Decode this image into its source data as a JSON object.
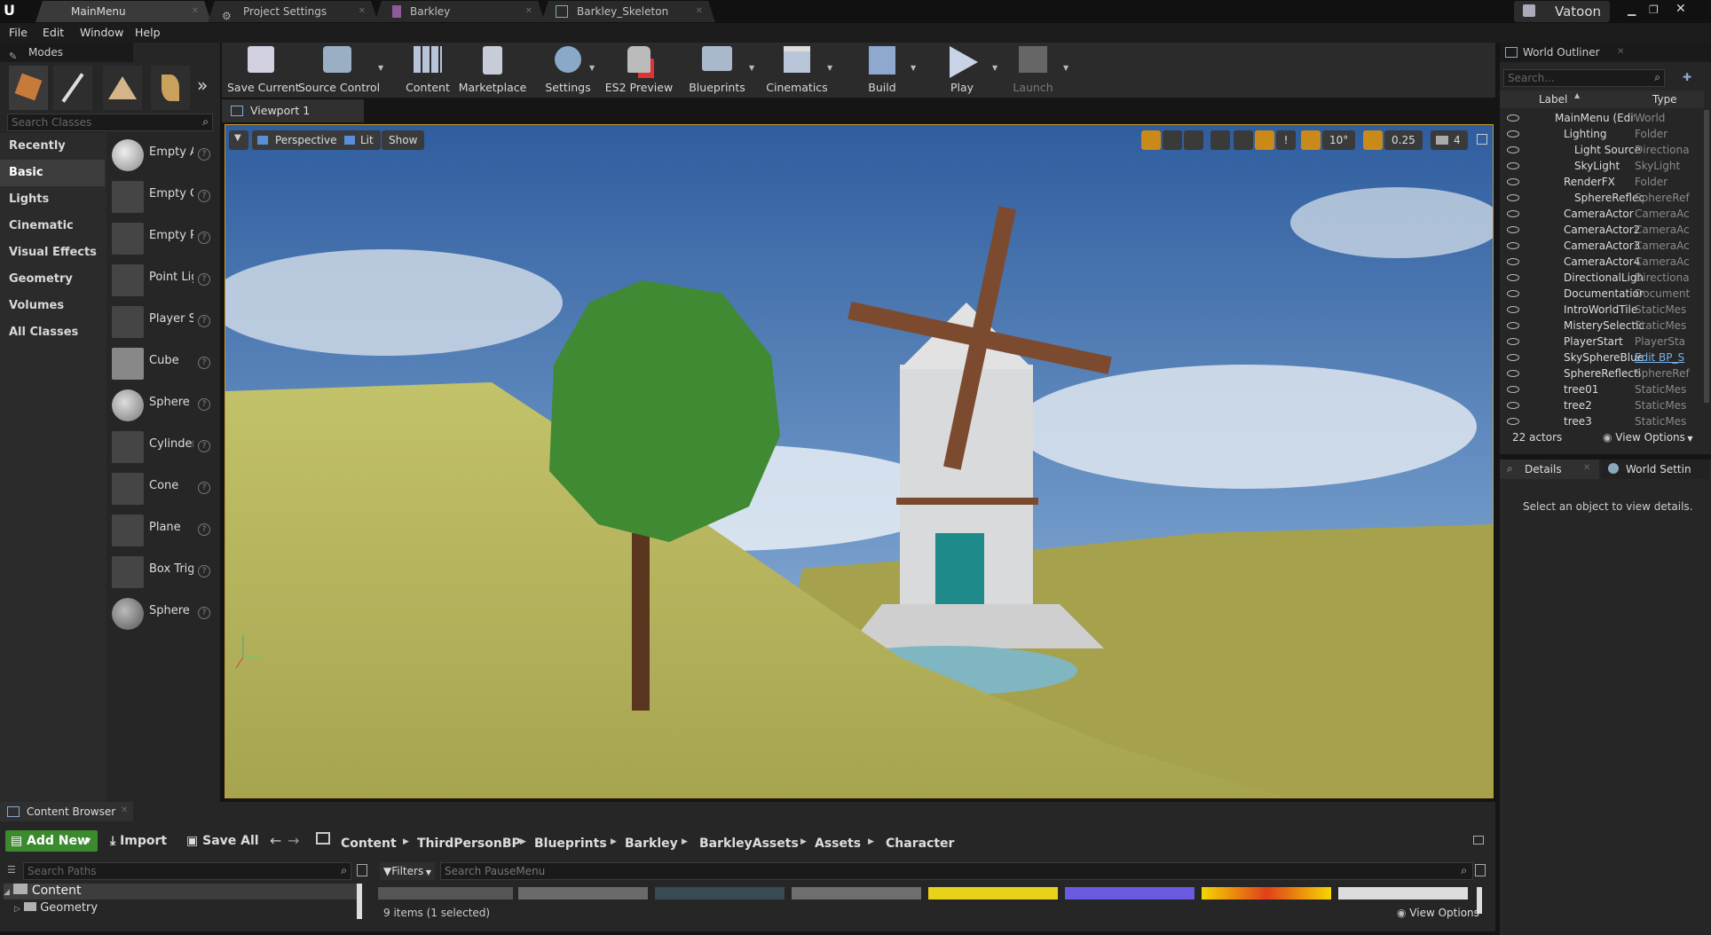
{
  "tabs": [
    {
      "label": "MainMenu"
    },
    {
      "label": "Project Settings"
    },
    {
      "label": "Barkley"
    },
    {
      "label": "Barkley_Skeleton"
    }
  ],
  "user": "Vatoon",
  "menu": [
    "File",
    "Edit",
    "Window",
    "Help"
  ],
  "modes": {
    "title": "Modes",
    "search_placeholder": "Search Classes",
    "categories": [
      "Recently Placed",
      "Basic",
      "Lights",
      "Cinematic",
      "Visual Effects",
      "Geometry",
      "Volumes",
      "All Classes"
    ],
    "items": [
      "Empty A",
      "Empty C",
      "Empty P",
      "Point Lig",
      "Player S",
      "Cube",
      "Sphere",
      "Cylinder",
      "Cone",
      "Plane",
      "Box Trig",
      "Sphere"
    ]
  },
  "toolbar": [
    "Save Current",
    "Source Control",
    "Content",
    "Marketplace",
    "Settings",
    "ES2 Preview",
    "Blueprints",
    "Cinematics",
    "Build",
    "Play",
    "Launch"
  ],
  "viewport": {
    "tab": "Viewport 1",
    "perspective": "Perspective",
    "lit": "Lit",
    "show": "Show",
    "rot": "10°",
    "scale": "0.25",
    "cam": "4"
  },
  "outliner": {
    "title": "World Outliner",
    "search": "Search...",
    "col_label": "Label",
    "col_type": "Type",
    "rows": [
      {
        "label": "MainMenu (Edito",
        "type": "World"
      },
      {
        "label": "Lighting",
        "type": "Folder"
      },
      {
        "label": "Light Source",
        "type": "Directiona"
      },
      {
        "label": "SkyLight",
        "type": "SkyLight"
      },
      {
        "label": "RenderFX",
        "type": "Folder"
      },
      {
        "label": "SphereReflec",
        "type": "SphereRef"
      },
      {
        "label": "CameraActor",
        "type": "CameraAc"
      },
      {
        "label": "CameraActor2",
        "type": "CameraAc"
      },
      {
        "label": "CameraActor3",
        "type": "CameraAc"
      },
      {
        "label": "CameraActor4",
        "type": "CameraAc"
      },
      {
        "label": "DirectionalLigh",
        "type": "Directiona"
      },
      {
        "label": "Documentation",
        "type": "Document"
      },
      {
        "label": "IntroWorldTile",
        "type": "StaticMes"
      },
      {
        "label": "MisterySelectio",
        "type": "StaticMes"
      },
      {
        "label": "PlayerStart",
        "type": "PlayerSta"
      },
      {
        "label": "SkySphereBlue",
        "type": "Edit BP_S"
      },
      {
        "label": "SphereReflecti",
        "type": "SphereRef"
      },
      {
        "label": "tree01",
        "type": "StaticMes"
      },
      {
        "label": "tree2",
        "type": "StaticMes"
      },
      {
        "label": "tree3",
        "type": "StaticMes"
      }
    ],
    "count": "22 actors",
    "view_options": "View Options"
  },
  "details": {
    "tab1": "Details",
    "tab2": "World Settin",
    "empty": "Select an object to view details."
  },
  "content_browser": {
    "title": "Content Browser",
    "add_new": "Add New",
    "import": "Import",
    "save_all": "Save All",
    "crumbs": [
      "Content",
      "ThirdPersonBP",
      "Blueprints",
      "Barkley",
      "BarkleyAssets",
      "Assets",
      "Character"
    ],
    "search_paths": "Search Paths",
    "filters": "Filters",
    "search_assets": "Search PauseMenu",
    "tree": [
      "Content",
      "Geometry"
    ],
    "status": "9 items (1 selected)",
    "view_options": "View Options"
  }
}
